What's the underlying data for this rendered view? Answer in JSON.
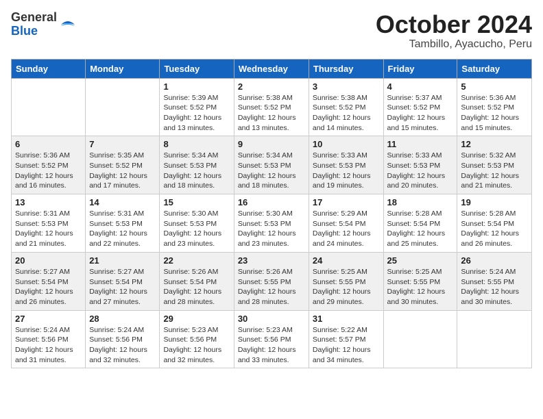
{
  "header": {
    "logo_general": "General",
    "logo_blue": "Blue",
    "month_title": "October 2024",
    "location": "Tambillo, Ayacucho, Peru"
  },
  "columns": [
    "Sunday",
    "Monday",
    "Tuesday",
    "Wednesday",
    "Thursday",
    "Friday",
    "Saturday"
  ],
  "weeks": [
    [
      {
        "day": "",
        "info": ""
      },
      {
        "day": "",
        "info": ""
      },
      {
        "day": "1",
        "info": "Sunrise: 5:39 AM\nSunset: 5:52 PM\nDaylight: 12 hours and 13 minutes."
      },
      {
        "day": "2",
        "info": "Sunrise: 5:38 AM\nSunset: 5:52 PM\nDaylight: 12 hours and 13 minutes."
      },
      {
        "day": "3",
        "info": "Sunrise: 5:38 AM\nSunset: 5:52 PM\nDaylight: 12 hours and 14 minutes."
      },
      {
        "day": "4",
        "info": "Sunrise: 5:37 AM\nSunset: 5:52 PM\nDaylight: 12 hours and 15 minutes."
      },
      {
        "day": "5",
        "info": "Sunrise: 5:36 AM\nSunset: 5:52 PM\nDaylight: 12 hours and 15 minutes."
      }
    ],
    [
      {
        "day": "6",
        "info": "Sunrise: 5:36 AM\nSunset: 5:52 PM\nDaylight: 12 hours and 16 minutes."
      },
      {
        "day": "7",
        "info": "Sunrise: 5:35 AM\nSunset: 5:52 PM\nDaylight: 12 hours and 17 minutes."
      },
      {
        "day": "8",
        "info": "Sunrise: 5:34 AM\nSunset: 5:53 PM\nDaylight: 12 hours and 18 minutes."
      },
      {
        "day": "9",
        "info": "Sunrise: 5:34 AM\nSunset: 5:53 PM\nDaylight: 12 hours and 18 minutes."
      },
      {
        "day": "10",
        "info": "Sunrise: 5:33 AM\nSunset: 5:53 PM\nDaylight: 12 hours and 19 minutes."
      },
      {
        "day": "11",
        "info": "Sunrise: 5:33 AM\nSunset: 5:53 PM\nDaylight: 12 hours and 20 minutes."
      },
      {
        "day": "12",
        "info": "Sunrise: 5:32 AM\nSunset: 5:53 PM\nDaylight: 12 hours and 21 minutes."
      }
    ],
    [
      {
        "day": "13",
        "info": "Sunrise: 5:31 AM\nSunset: 5:53 PM\nDaylight: 12 hours and 21 minutes."
      },
      {
        "day": "14",
        "info": "Sunrise: 5:31 AM\nSunset: 5:53 PM\nDaylight: 12 hours and 22 minutes."
      },
      {
        "day": "15",
        "info": "Sunrise: 5:30 AM\nSunset: 5:53 PM\nDaylight: 12 hours and 23 minutes."
      },
      {
        "day": "16",
        "info": "Sunrise: 5:30 AM\nSunset: 5:53 PM\nDaylight: 12 hours and 23 minutes."
      },
      {
        "day": "17",
        "info": "Sunrise: 5:29 AM\nSunset: 5:54 PM\nDaylight: 12 hours and 24 minutes."
      },
      {
        "day": "18",
        "info": "Sunrise: 5:28 AM\nSunset: 5:54 PM\nDaylight: 12 hours and 25 minutes."
      },
      {
        "day": "19",
        "info": "Sunrise: 5:28 AM\nSunset: 5:54 PM\nDaylight: 12 hours and 26 minutes."
      }
    ],
    [
      {
        "day": "20",
        "info": "Sunrise: 5:27 AM\nSunset: 5:54 PM\nDaylight: 12 hours and 26 minutes."
      },
      {
        "day": "21",
        "info": "Sunrise: 5:27 AM\nSunset: 5:54 PM\nDaylight: 12 hours and 27 minutes."
      },
      {
        "day": "22",
        "info": "Sunrise: 5:26 AM\nSunset: 5:54 PM\nDaylight: 12 hours and 28 minutes."
      },
      {
        "day": "23",
        "info": "Sunrise: 5:26 AM\nSunset: 5:55 PM\nDaylight: 12 hours and 28 minutes."
      },
      {
        "day": "24",
        "info": "Sunrise: 5:25 AM\nSunset: 5:55 PM\nDaylight: 12 hours and 29 minutes."
      },
      {
        "day": "25",
        "info": "Sunrise: 5:25 AM\nSunset: 5:55 PM\nDaylight: 12 hours and 30 minutes."
      },
      {
        "day": "26",
        "info": "Sunrise: 5:24 AM\nSunset: 5:55 PM\nDaylight: 12 hours and 30 minutes."
      }
    ],
    [
      {
        "day": "27",
        "info": "Sunrise: 5:24 AM\nSunset: 5:56 PM\nDaylight: 12 hours and 31 minutes."
      },
      {
        "day": "28",
        "info": "Sunrise: 5:24 AM\nSunset: 5:56 PM\nDaylight: 12 hours and 32 minutes."
      },
      {
        "day": "29",
        "info": "Sunrise: 5:23 AM\nSunset: 5:56 PM\nDaylight: 12 hours and 32 minutes."
      },
      {
        "day": "30",
        "info": "Sunrise: 5:23 AM\nSunset: 5:56 PM\nDaylight: 12 hours and 33 minutes."
      },
      {
        "day": "31",
        "info": "Sunrise: 5:22 AM\nSunset: 5:57 PM\nDaylight: 12 hours and 34 minutes."
      },
      {
        "day": "",
        "info": ""
      },
      {
        "day": "",
        "info": ""
      }
    ]
  ]
}
